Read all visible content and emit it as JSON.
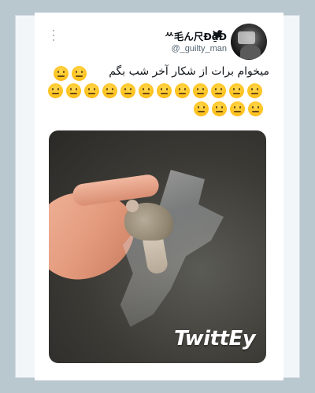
{
  "tweet": {
    "display_name": "ᄊ毛ん尺Ð₫Ð",
    "handle": "@_guilty_man",
    "text": "میخوام برات از شکار آخر شب بگم",
    "emoji_name": "neutral-face",
    "emoji_count_row1": 2,
    "emoji_count_row2": 12,
    "emoji_count_row3": 4
  },
  "media": {
    "watermark": "TwittEy"
  },
  "colors": {
    "background": "#b9c7cf",
    "card": "#ffffff",
    "text": "#0f1419",
    "handle": "#536471",
    "emoji": "#ffc21c"
  }
}
